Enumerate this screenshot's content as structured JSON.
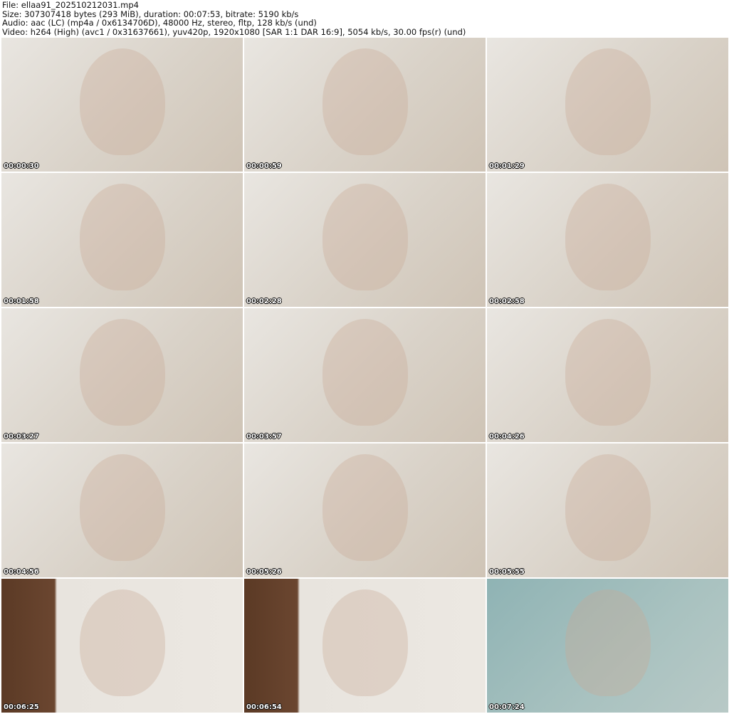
{
  "header": {
    "file": "File: ellaa91_202510212031.mp4",
    "size": "Size: 307307418 bytes (293 MiB), duration: 00:07:53, bitrate: 5190 kb/s",
    "audio": "Audio: aac (LC) (mp4a / 0x6134706D), 48000 Hz, stereo, fltp, 128 kb/s (und)",
    "video": "Video: h264 (High) (avc1 / 0x31637661), yuv420p, 1920x1080 [SAR 1:1 DAR 16:9], 5054 kb/s, 30.00 fps(r) (und)"
  },
  "thumbnails": [
    {
      "timestamp": "00:00:30"
    },
    {
      "timestamp": "00:00:59"
    },
    {
      "timestamp": "00:01:29"
    },
    {
      "timestamp": "00:01:58"
    },
    {
      "timestamp": "00:02:28"
    },
    {
      "timestamp": "00:02:58"
    },
    {
      "timestamp": "00:03:27"
    },
    {
      "timestamp": "00:03:57"
    },
    {
      "timestamp": "00:04:26"
    },
    {
      "timestamp": "00:04:56"
    },
    {
      "timestamp": "00:05:26"
    },
    {
      "timestamp": "00:05:55"
    },
    {
      "timestamp": "00:06:25"
    },
    {
      "timestamp": "00:06:54"
    },
    {
      "timestamp": "00:07:24"
    }
  ]
}
